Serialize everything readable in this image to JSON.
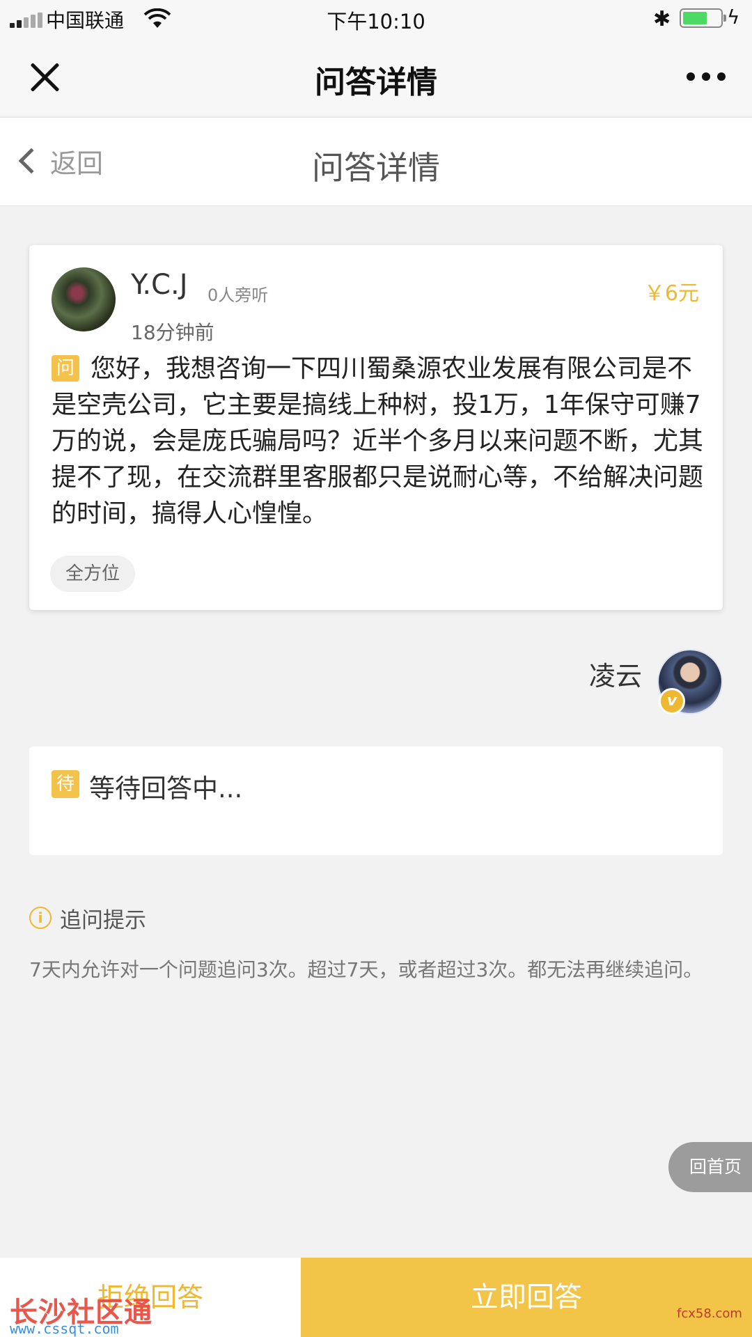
{
  "status_bar": {
    "carrier": "中国联通",
    "time": "下午10:10",
    "battery_color": "#4cd964"
  },
  "wechat_nav": {
    "title": "问答详情",
    "close_icon": "close-icon",
    "more_icon": "more-dots-icon"
  },
  "header": {
    "back_label": "返回",
    "title": "问答详情"
  },
  "question": {
    "user": "Y.C.J",
    "listeners": "0人旁听",
    "time": "18分钟前",
    "price": "￥6元",
    "tag": "问",
    "text": "您好，我想咨询一下四川蜀桑源农业发展有限公司是不是空壳公司，它主要是搞线上种树，投1万，1年保守可赚7万的说，会是庞氏骗局吗？近半个多月以来问题不断，尤其提不了现，在交流群里客服都只是说耐心等，不给解决问题的时间，搞得人心惶惶。",
    "category": "全方位"
  },
  "answerer": {
    "name": "凌云",
    "badge": "v"
  },
  "waiting": {
    "tag": "待",
    "text": "等待回答中..."
  },
  "tip": {
    "title": "追问提示",
    "icon": "i",
    "text": "7天内允许对一个问题追问3次。超过7天，或者超过3次。都无法再继续追问。"
  },
  "home_button": "回首页",
  "bottom": {
    "reject_label": "拒绝回答",
    "answer_label": "立即回答"
  },
  "watermarks": {
    "left_logo": "长沙社区通",
    "left_url": "www.cssqt.com",
    "right": "fcx58.com"
  },
  "colors": {
    "accent": "#f2c447",
    "price": "#f0b830"
  }
}
